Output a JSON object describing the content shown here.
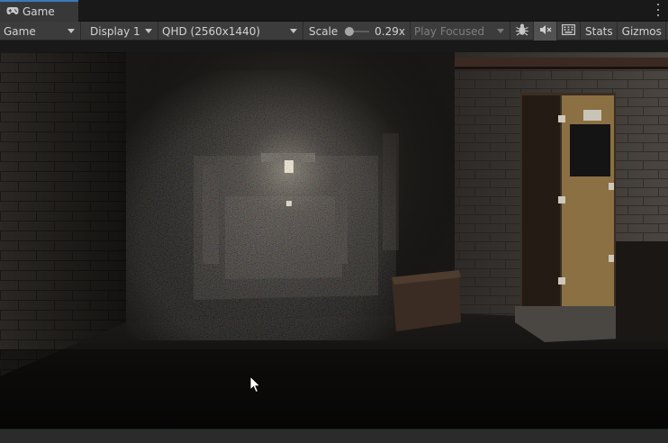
{
  "tab": {
    "label": "Game",
    "icon": "gamepad-icon"
  },
  "toolbar": {
    "view_mode": "Game",
    "display": "Display 1",
    "resolution": "QHD (2560x1440)",
    "scale_label": "Scale",
    "scale_value": "0.29x",
    "scale_fraction": 0.0,
    "play_mode": "Play Focused",
    "bug_icon": "bug-icon",
    "mute_icon": "mute-audio-icon",
    "stats_icon": "keyboard-grid-icon",
    "stats_label": "Stats",
    "gizmos_label": "Gizmos"
  },
  "colors": {
    "accent": "#3a79bb",
    "toolbar_bg": "#3c3c3c",
    "panel_bg": "#191919",
    "tab_bg": "#383838"
  }
}
